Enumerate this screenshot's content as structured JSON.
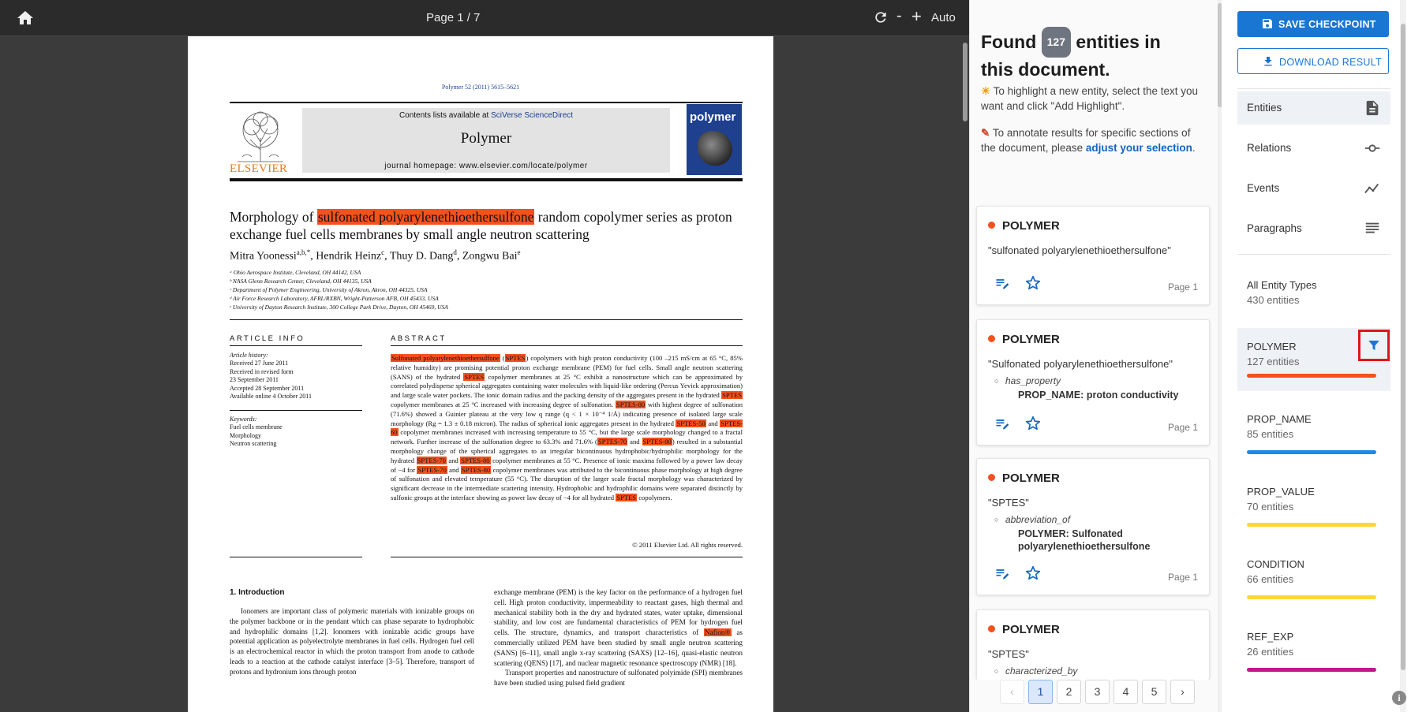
{
  "toolbar": {
    "page_indicator": "Page 1 / 7",
    "zoom_minus": "-",
    "zoom_plus": "+",
    "zoom_mode": "Auto",
    "icons": [
      "home-icon",
      "refresh-icon"
    ]
  },
  "pdf": {
    "journal_ref": "Polymer 52 (2011) 5615–5621",
    "contents_prefix": "Contents lists available at ",
    "contents_link": "SciVerse ScienceDirect",
    "journal_name": "Polymer",
    "homepage": "journal homepage: www.elsevier.com/locate/polymer",
    "publisher": "ELSEVIER",
    "cover_title": "polymer",
    "title_pre": "Morphology of ",
    "title_highlight": "sulfonated polyarylenethioethersulfone",
    "title_post": " random copolymer series as proton exchange fuel cells membranes by small angle neutron scattering",
    "authors": [
      {
        "name": "Mitra Yoonessi",
        "sup": "a,b,*"
      },
      {
        "name": "Hendrik Heinz",
        "sup": "c"
      },
      {
        "name": "Thuy D. Dang",
        "sup": "d"
      },
      {
        "name": "Zongwu Bai",
        "sup": "e"
      }
    ],
    "affiliations": [
      "ᵃ Ohio Aerospace Institute, Cleveland, OH 44142, USA",
      "ᵇ NASA Glenn Research Center, Cleveland, OH 44135, USA",
      "ᶜ Department of Polymer Engineering, University of Akron, Akron, OH 44325, USA",
      "ᵈ Air Force Research Laboratory, AFRL/RXBN, Wright-Patterson AFB, OH 45433, USA",
      "ᵉ University of Dayton Research Institute, 300 College Park Drive, Dayton, OH 45469, USA"
    ],
    "article_info_head": "ARTICLE INFO",
    "history_label": "Article history:",
    "history": [
      "Received 27 June 2011",
      "Received in revised form",
      "23 September 2011",
      "Accepted 28 September 2011",
      "Available online 4 October 2011"
    ],
    "keywords_label": "Keywords:",
    "keywords": [
      "Fuel cells membrane",
      "Morphology",
      "Neutron scattering"
    ],
    "abstract_head": "ABSTRACT",
    "abstract_segments": [
      {
        "t": "Sulfonated polyarylenethioethersulfone",
        "h": true
      },
      {
        "t": " (",
        "h": false
      },
      {
        "t": "SPTES",
        "h": true
      },
      {
        "t": ") copolymers with high proton conductivity (100 –215 mS/cm at 65 °C, 85% relative humidity) are promising potential proton exchange membrane (PEM) for fuel cells. Small angle neutron scattering (SANS) of the hydrated ",
        "h": false
      },
      {
        "t": "SPTES",
        "h": true
      },
      {
        "t": " copolymer membranes at 25 °C exhibit a nanostructure which can be approximated by correlated polydisperse spherical aggregates containing water molecules with liquid-like ordering (Percus Yevick approximation) and large scale water pockets. The ionic domain radius and the packing density of the aggregates present in the hydrated ",
        "h": false
      },
      {
        "t": "SPTES",
        "h": true
      },
      {
        "t": " copolymer membranes at 25 °C increased with increasing degree of sulfonation. ",
        "h": false
      },
      {
        "t": "SPTES-80",
        "h": true
      },
      {
        "t": " with highest degree of sulfonation (71.6%) showed a Guinier plateau at the very low q range (q < 1 × 10⁻⁴ 1/Å) indicating presence of isolated large scale morphology (Rg = 1.3 ± 0.18 micron). The radius of spherical ionic aggregates present in the hydrated ",
        "h": false
      },
      {
        "t": "SPTES-50",
        "h": true
      },
      {
        "t": " and ",
        "h": false
      },
      {
        "t": "SPTES-60",
        "h": true
      },
      {
        "t": " copolymer membranes increased with increasing temperature to 55 °C, but the large scale morphology changed to a fractal network. Further increase of the sulfonation degree to 63.3% and 71.6% (",
        "h": false
      },
      {
        "t": "SPTES-70",
        "h": true
      },
      {
        "t": " and ",
        "h": false
      },
      {
        "t": "SPTES-80",
        "h": true
      },
      {
        "t": ") resulted in a substantial morphology change of the spherical aggregates to an irregular bicontinuous hydrophobic/hydrophilic morphology for the hydrated ",
        "h": false
      },
      {
        "t": "SPTES-70",
        "h": true
      },
      {
        "t": " and ",
        "h": false
      },
      {
        "t": "SPTES-80",
        "h": true
      },
      {
        "t": " copolymer membranes at 55 °C. Presence of ionic maxima followed by a power law decay of −4 for ",
        "h": false
      },
      {
        "t": "SPTES-70",
        "h": true
      },
      {
        "t": " and ",
        "h": false
      },
      {
        "t": "SPTES-80",
        "h": true
      },
      {
        "t": " copolymer membranes was attributed to the bicontinuous phase morphology at high degree of sulfonation and elevated temperature (55 °C). The disruption of the larger scale fractal morphology was characterized by significant decrease in the intermediate scattering intensity. Hydrophobic and hydrophilic domains were separated distinctly by sulfonic groups at the interface showing as power law decay of −4 for all hydrated ",
        "h": false
      },
      {
        "t": "SPTES",
        "h": true
      },
      {
        "t": " copolymers.",
        "h": false
      }
    ],
    "copyright": "© 2011 Elsevier Ltd. All rights reserved.",
    "intro_head": "1.  Introduction",
    "intro_left": "Ionomers are important class of polymeric materials with ionizable groups on the polymer backbone or in the pendant which can phase separate to hydrophobic and hydrophilic domains [1,2]. Ionomers with ionizable acidic groups have potential application as polyelectrolyte membranes in fuel cells. Hydrogen fuel cell is an electrochemical reactor in which the proton transport from anode to cathode leads to a reaction at the cathode catalyst interface [3–5]. Therefore, transport of protons and hydronium ions through proton",
    "intro_right_pre": "exchange membrane (PEM) is the key factor on the performance of a hydrogen fuel cell. High proton conductivity, impermeability to reactant gases, high thermal and mechanical stability both in the dry and hydrated states, water uptake, dimensional stability, and low cost are fundamental characteristics of PEM for hydrogen fuel cells. The structure, dynamics, and transport characteristics of ",
    "intro_right_hl": "Nafion®",
    "intro_right_post": " as commercially utilized PEM have been studied by small angle neutron scattering (SANS) [6–11], small angle x-ray scattering (SAXS) [12–16], quasi-elastic neutron scattering (QENS) [17], and nuclear magnetic resonance spectroscopy (NMR) [18].",
    "intro_right_p2": "Transport properties and nanostructure of sulfonated polyimide (SPI) membranes have been studied using pulsed field gradient"
  },
  "entities_panel": {
    "found_pre": "Found",
    "found_count": "127",
    "found_post": "entities in this document.",
    "hint1_emoji": "☀",
    "hint1": " To highlight a new entity, select the text you want and click \"Add Highlight\".",
    "hint2_emoji": "✎",
    "hint2_pre": " To annotate results for specific sections of the document, please ",
    "hint2_link": "adjust your selection",
    "hint2_post": ".",
    "cards": [
      {
        "type": "POLYMER",
        "text": "\"sulfonated polyarylenethioethersulfone\"",
        "page": "Page 1"
      },
      {
        "type": "POLYMER",
        "text": "\"Sulfonated polyarylenethioethersulfone\"",
        "relation": "has_property",
        "target": "PROP_NAME: proton conductivity",
        "page": "Page 1"
      },
      {
        "type": "POLYMER",
        "text": "\"SPTES\"",
        "relation": "abbreviation_of",
        "target": "POLYMER: Sulfonated polyarylenethioethersulfone",
        "page": "Page 1"
      },
      {
        "type": "POLYMER",
        "text": "\"SPTES\"",
        "relation": "characterized_by"
      }
    ],
    "pagination": {
      "prev": "‹",
      "pages": [
        "1",
        "2",
        "3",
        "4",
        "5"
      ],
      "next": "›",
      "current": "1"
    }
  },
  "sidebar": {
    "save_label": "SAVE CHECKPOINT",
    "download_label": "DOWNLOAD RESULT",
    "nav": [
      {
        "label": "Entities",
        "icon": "document-icon"
      },
      {
        "label": "Relations",
        "icon": "commit-icon"
      },
      {
        "label": "Events",
        "icon": "timeline-icon"
      },
      {
        "label": "Paragraphs",
        "icon": "paragraph-icon"
      }
    ],
    "entity_types": [
      {
        "name": "All Entity Types",
        "count": "430 entities",
        "color": ""
      },
      {
        "name": "POLYMER",
        "count": "127 entities",
        "color": "#f4511e"
      },
      {
        "name": "PROP_NAME",
        "count": "85 entities",
        "color": "#1e88e5"
      },
      {
        "name": "PROP_VALUE",
        "count": "70 entities",
        "color": "#fdd835"
      },
      {
        "name": "CONDITION",
        "count": "66 entities",
        "color": "#fdd835"
      },
      {
        "name": "REF_EXP",
        "count": "26 entities",
        "color": "#c2188b"
      }
    ],
    "info_label": "i"
  }
}
